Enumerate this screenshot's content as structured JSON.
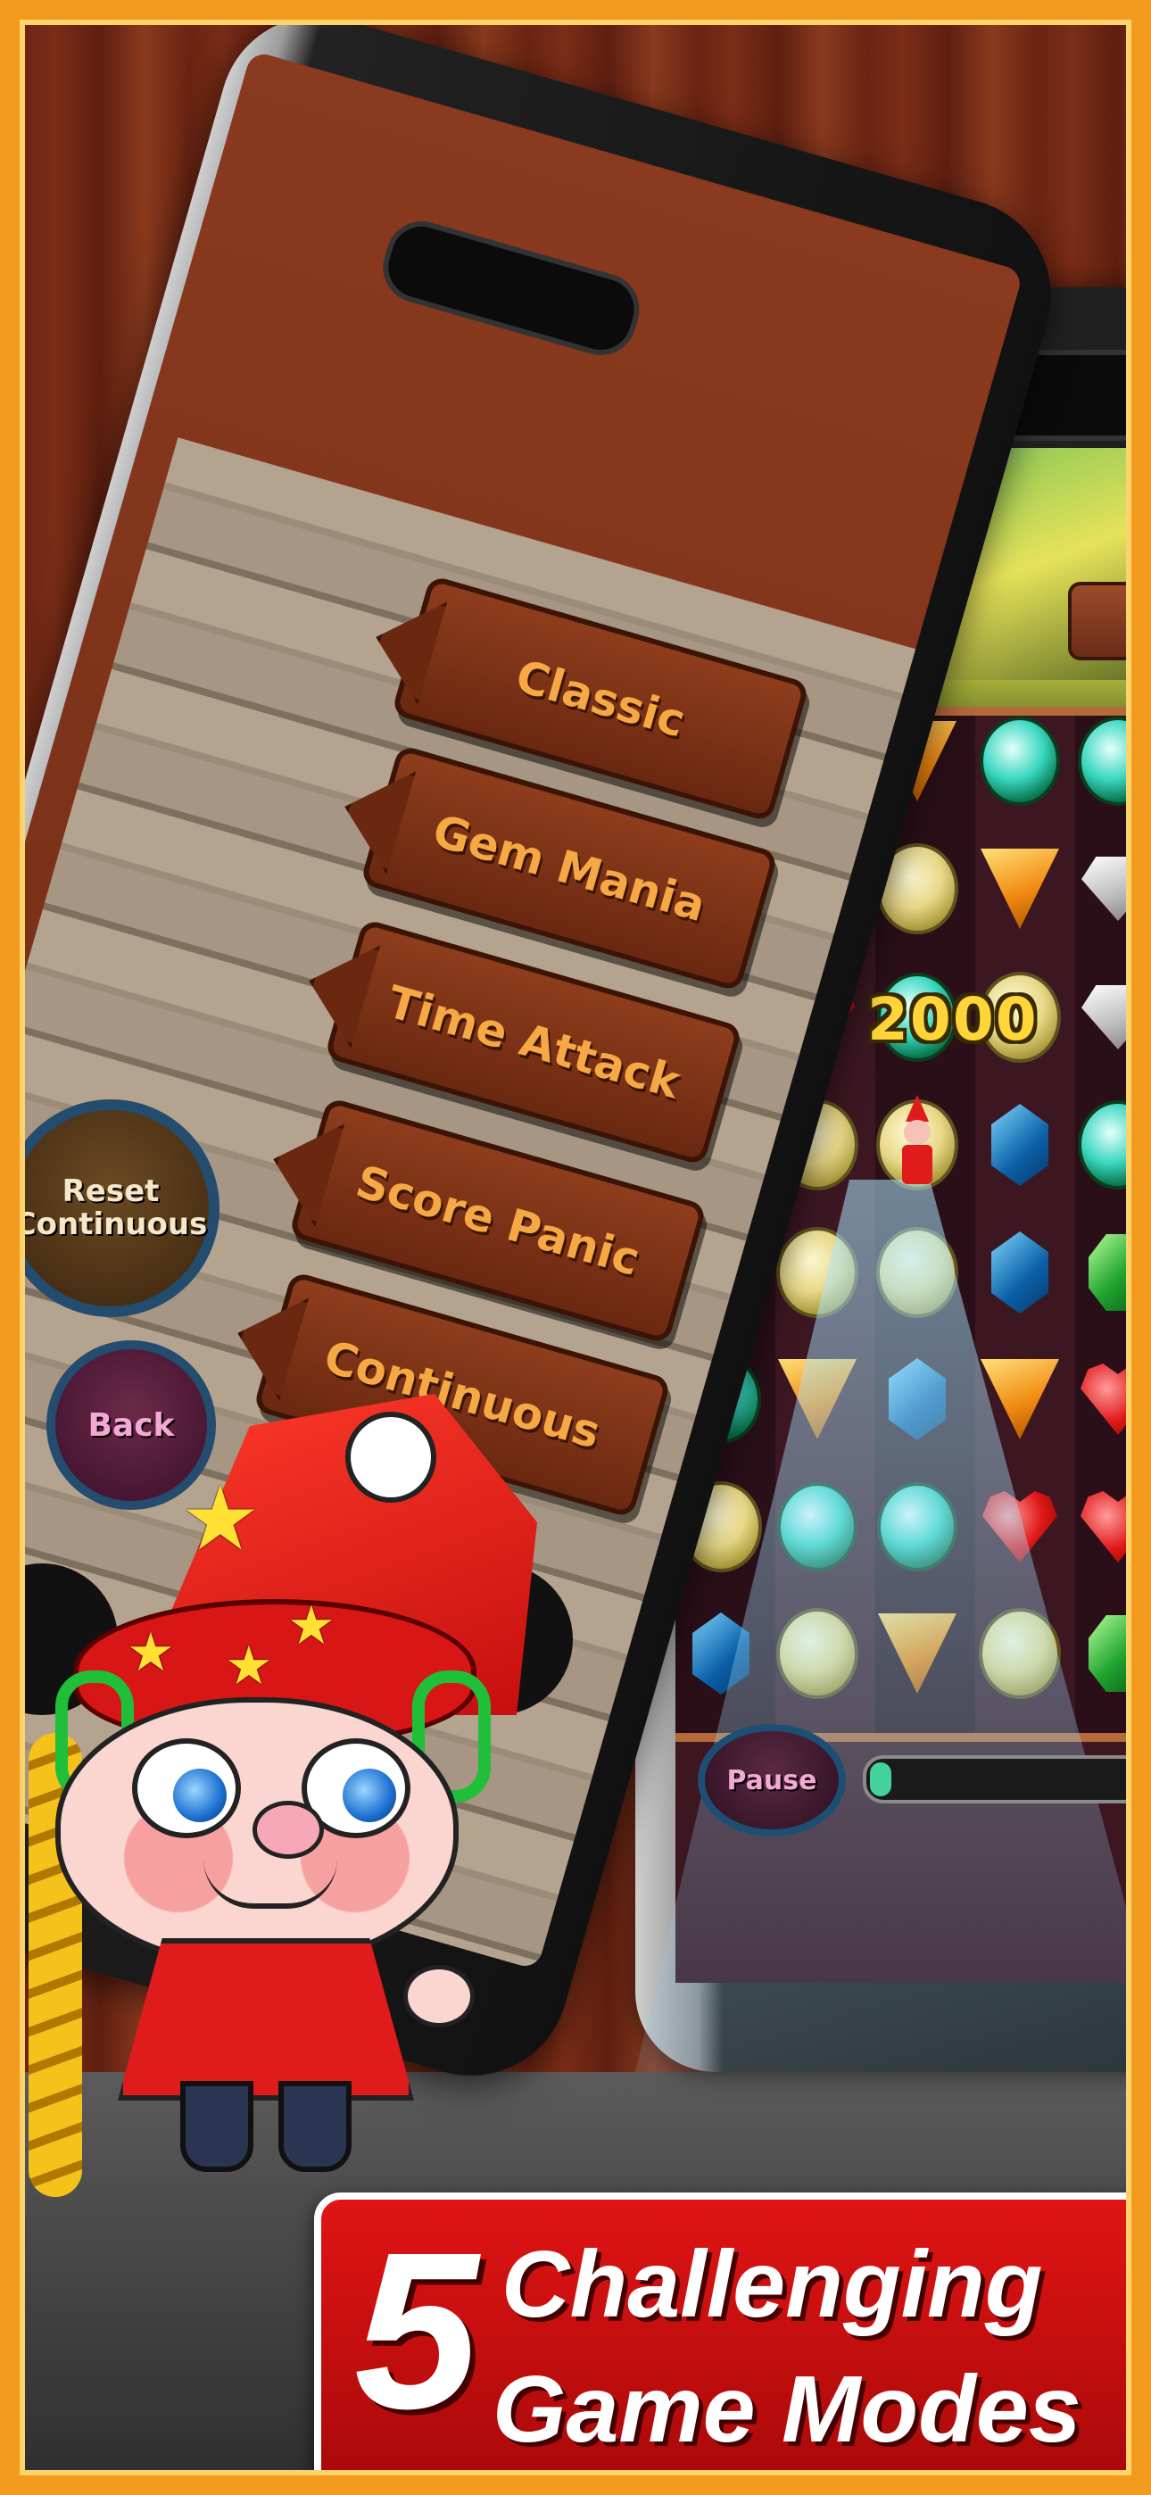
{
  "menu": {
    "buttons": [
      {
        "label": "Classic"
      },
      {
        "label": "Gem Mania"
      },
      {
        "label": "Time Attack"
      },
      {
        "label": "Score Panic"
      },
      {
        "label": "Continuous"
      }
    ],
    "reset_label": "Reset Continuous",
    "back_label": "Back"
  },
  "game": {
    "score_popup": "2000",
    "pause_label": "Pause",
    "progress_fraction": 0.05,
    "board_rows": [
      [
        "blue",
        "orange",
        "green",
        "green"
      ],
      [
        "yellow",
        "yellow",
        "orange",
        "white"
      ],
      [
        "red",
        "green",
        "yellow",
        "white"
      ],
      [
        "yellow",
        "yellow",
        "blue",
        "green"
      ],
      [
        "yellow",
        "yellow",
        "yellow",
        "blue",
        "emerald"
      ],
      [
        "green",
        "orange",
        "blue",
        "orange",
        "red"
      ],
      [
        "yellow",
        "green",
        "green",
        "red",
        "red"
      ],
      [
        "blue",
        "yellow",
        "orange",
        "yellow",
        "emerald"
      ]
    ]
  },
  "banner": {
    "number": "5",
    "line1": "Challenging",
    "line2": "Game Modes"
  },
  "colors": {
    "frame": "#f39a1e",
    "banner": "#d01010",
    "menu_text": "#f5a844"
  }
}
